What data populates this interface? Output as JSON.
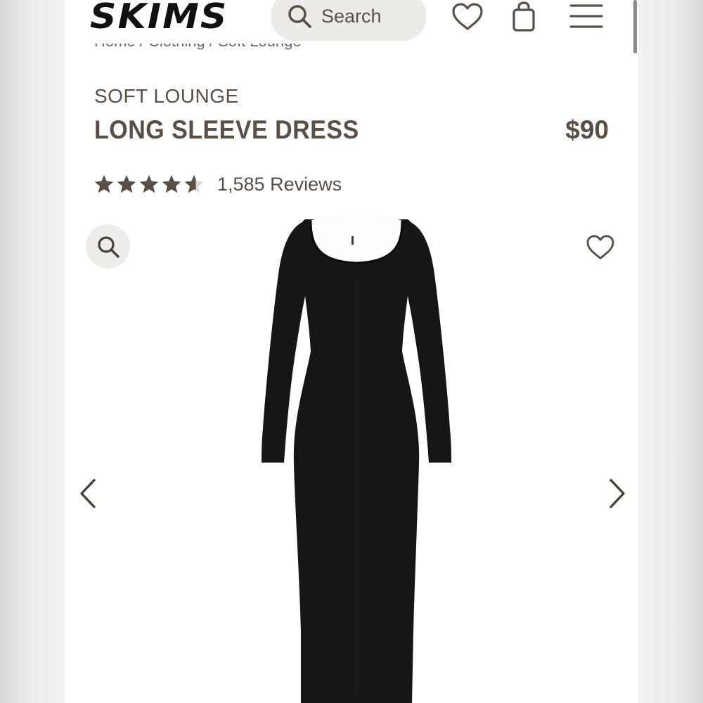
{
  "header": {
    "logo": "SKIMS",
    "search_placeholder": "Search",
    "icons": [
      "search-icon",
      "heart-icon",
      "shopping-bag-icon",
      "menu-icon"
    ]
  },
  "breadcrumb": "Home / Clothing / Soft Lounge",
  "product": {
    "collection": "SOFT LOUNGE",
    "title": "LONG SLEEVE DRESS",
    "price": "$90",
    "rating": 4.5,
    "reviews": "1,585 Reviews"
  },
  "gallery": {
    "icons": [
      "zoom-icon",
      "heart-icon",
      "chevron-left-icon",
      "chevron-right-icon"
    ],
    "image": "black long sleeve maxi dress"
  },
  "colors": {
    "text": "#5b4f45",
    "logo": "#111111",
    "search_bg": "#ecebe8",
    "dress": "#161616"
  }
}
